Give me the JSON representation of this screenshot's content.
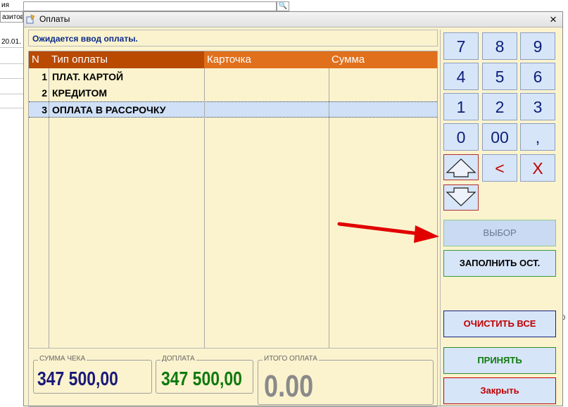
{
  "background": {
    "row1": "ия",
    "row2": "азитов",
    "row3": "20.01.",
    "right_digit": "0"
  },
  "dialog": {
    "title": "Оплаты",
    "close": "×",
    "status": "Ожидается ввод оплаты."
  },
  "grid": {
    "columns": [
      "N",
      "Тип оплаты",
      "Карточка",
      "Сумма"
    ],
    "rows": [
      {
        "n": "1",
        "type": "ПЛАТ. КАРТОЙ",
        "card": "",
        "sum": ""
      },
      {
        "n": "2",
        "type": "КРЕДИТОМ",
        "card": "",
        "sum": ""
      },
      {
        "n": "3",
        "type": "ОПЛАТА В РАССРОЧКУ",
        "card": "",
        "sum": ""
      }
    ],
    "selected_row": 3
  },
  "summary": {
    "check_label": "СУММА ЧЕКА",
    "check_value": "347 500,00",
    "extra_label": "ДОПЛАТА",
    "extra_value": "347 500,00",
    "total_label": "ИТОГО ОПЛАТА",
    "total_value": "0.00"
  },
  "keypad": {
    "keys": [
      "7",
      "8",
      "9",
      "4",
      "5",
      "6",
      "1",
      "2",
      "3",
      "0",
      "00",
      ",",
      "<",
      "X"
    ]
  },
  "actions": {
    "select": "ВЫБОР",
    "fill_rest": "ЗАПОЛНИТЬ ОСТ.",
    "clear_all": "ОЧИСТИТЬ ВСЕ",
    "accept": "ПРИНЯТЬ",
    "close": "Закрыть"
  },
  "colors": {
    "dialog_bg": "#fbf3ce",
    "header_dark": "#b94a00",
    "header_light": "#e0701c",
    "key_bg": "#d7e5f8",
    "key_text": "#0a1f7a",
    "check_value": "#1a1a78",
    "extra_value": "#0f7a0f",
    "total_value": "#8a8a8a",
    "annotation_arrow": "#e00000"
  }
}
